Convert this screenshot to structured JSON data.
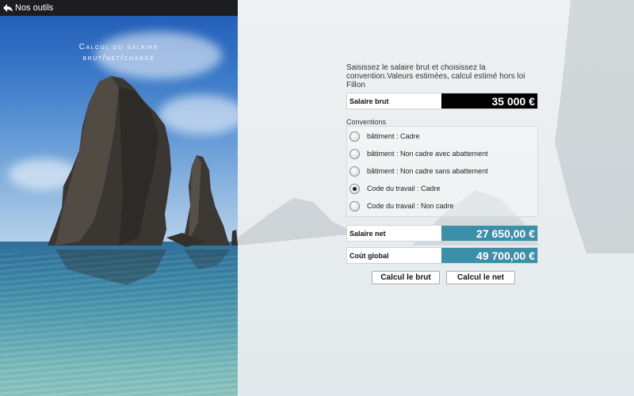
{
  "topbar": {
    "back_label": "Nos outils"
  },
  "panel": {
    "title_line1": "Calcul du salaire",
    "title_line2": "brut/net/chargé"
  },
  "form": {
    "intro": "Saisissez le salaire brut et choisissez la convention.Valeurs estimées, calcul estimé hors loi Fillon",
    "salaire_brut": {
      "label": "Salaire brut",
      "value": "35 000 €"
    },
    "conventions_label": "Conventions",
    "conventions": [
      {
        "label": "bâtiment : Cadre",
        "checked": false
      },
      {
        "label": "bâtiment : Non cadre avec abattement",
        "checked": false
      },
      {
        "label": "bâtiment : Non cadre sans abattement",
        "checked": false
      },
      {
        "label": "Code du travail : Cadre",
        "checked": true
      },
      {
        "label": "Code du travail : Non cadre",
        "checked": false
      }
    ],
    "salaire_net": {
      "label": "Salaire net",
      "value": "27 650,00 €"
    },
    "cout_global": {
      "label": "Coût global",
      "value": "49 700,00 €"
    },
    "buttons": {
      "calc_brut": "Calcul le brut",
      "calc_net": "Calcul le net"
    }
  },
  "colors": {
    "result_bg": "#3b8fa8",
    "input_bg": "#000000",
    "topbar_bg": "#1d1d1f"
  }
}
